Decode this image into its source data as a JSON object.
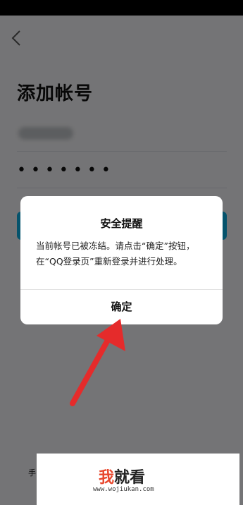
{
  "page": {
    "title": "添加帐号",
    "password_mask": "•••••••",
    "bottom_link_char": "手"
  },
  "dialog": {
    "title": "安全提醒",
    "message": "当前帐号已被冻结。请点击“确定”按钮，在“QQ登录页”重新登录并进行处理。",
    "confirm_label": "确定"
  },
  "watermark": {
    "logo_red": "我",
    "logo_black": "就看",
    "url": "www.wojiukan.com"
  },
  "colors": {
    "login_button": "#0aa7d9",
    "arrow": "#e52b2b",
    "overlay": "rgba(0,0,0,0.5)"
  },
  "icons": {
    "back": "chevron-left-icon",
    "arrow": "red-arrow-annotation"
  }
}
